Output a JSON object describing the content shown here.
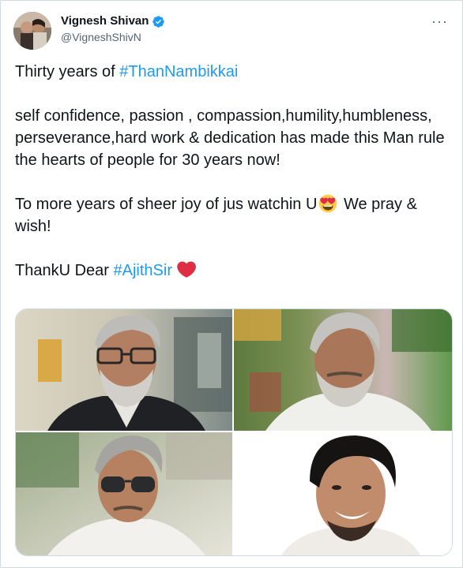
{
  "author": {
    "display_name": "Vignesh Shivan",
    "handle": "@VigneshShivN",
    "verified": true,
    "verified_color": "#1d9bf0"
  },
  "tweet": {
    "line1_text": "Thirty years of ",
    "line1_hashtag": "#ThanNambikkai",
    "para2": "self confidence, passion , compassion,humility,humbleness, perseverance,hard work & dedication has made this Man rule the hearts of people for 30 years now!",
    "para3_before": "To more years of sheer joy of jus watchin U",
    "para3_after": " We pray & wish!",
    "para4_text": "ThankU Dear ",
    "para4_hashtag": "#AjithSir"
  },
  "icons": {
    "more": "more-options-icon",
    "verified": "verified-badge-icon",
    "emoji": "heart-eyes-emoji-icon",
    "heart": "red-heart-emoji-icon"
  },
  "media": {
    "count": 4,
    "photos": [
      "photo-1",
      "photo-2",
      "photo-3",
      "photo-4"
    ]
  },
  "colors": {
    "hashtag": "#1d9bf0",
    "text": "#0f1419",
    "secondary": "#536471",
    "border": "#cfd9de"
  }
}
